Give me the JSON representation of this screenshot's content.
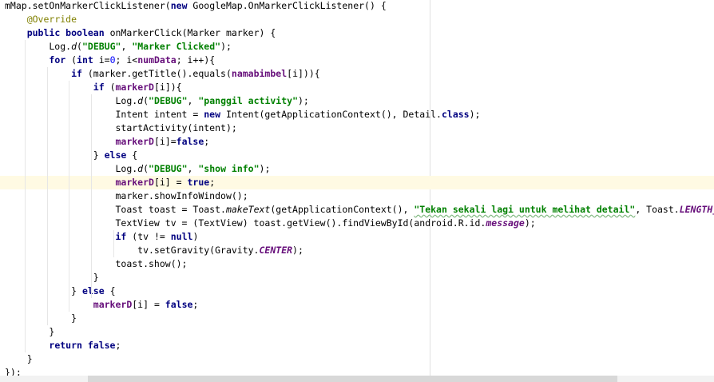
{
  "editor": {
    "lines": [
      [
        {
          "t": "mMap.setOnMarkerClickListener(",
          "c": "t-plain"
        },
        {
          "t": "new",
          "c": "t-kw"
        },
        {
          "t": " GoogleMap.OnMarkerClickListener() {",
          "c": "t-plain"
        }
      ],
      [
        {
          "t": "    ",
          "c": "t-plain"
        },
        {
          "t": "@Override",
          "c": "t-ann"
        }
      ],
      [
        {
          "t": "    ",
          "c": "t-plain"
        },
        {
          "t": "public boolean",
          "c": "t-kw"
        },
        {
          "t": " onMarkerClick(Marker marker) {",
          "c": "t-plain"
        }
      ],
      [
        {
          "t": "        Log.",
          "c": "t-plain"
        },
        {
          "t": "d",
          "c": "t-smeth"
        },
        {
          "t": "(",
          "c": "t-plain"
        },
        {
          "t": "\"DEBUG\"",
          "c": "t-str"
        },
        {
          "t": ", ",
          "c": "t-plain"
        },
        {
          "t": "\"Marker Clicked\"",
          "c": "t-str"
        },
        {
          "t": ");",
          "c": "t-plain"
        }
      ],
      [
        {
          "t": "        ",
          "c": "t-plain"
        },
        {
          "t": "for",
          "c": "t-kw"
        },
        {
          "t": " (",
          "c": "t-plain"
        },
        {
          "t": "int",
          "c": "t-kw"
        },
        {
          "t": " i=",
          "c": "t-plain"
        },
        {
          "t": "0",
          "c": "t-num"
        },
        {
          "t": "; i<",
          "c": "t-plain"
        },
        {
          "t": "numData",
          "c": "t-field"
        },
        {
          "t": "; i++){",
          "c": "t-plain"
        }
      ],
      [
        {
          "t": "            ",
          "c": "t-plain"
        },
        {
          "t": "if",
          "c": "t-kw"
        },
        {
          "t": " (marker.getTitle().equals(",
          "c": "t-plain"
        },
        {
          "t": "namabimbel",
          "c": "t-field"
        },
        {
          "t": "[i])){",
          "c": "t-plain"
        }
      ],
      [
        {
          "t": "                ",
          "c": "t-plain"
        },
        {
          "t": "if",
          "c": "t-kw"
        },
        {
          "t": " (",
          "c": "t-plain"
        },
        {
          "t": "markerD",
          "c": "t-field"
        },
        {
          "t": "[i]){",
          "c": "t-plain"
        }
      ],
      [
        {
          "t": "                    Log.",
          "c": "t-plain"
        },
        {
          "t": "d",
          "c": "t-smeth"
        },
        {
          "t": "(",
          "c": "t-plain"
        },
        {
          "t": "\"DEBUG\"",
          "c": "t-str"
        },
        {
          "t": ", ",
          "c": "t-plain"
        },
        {
          "t": "\"panggil activity\"",
          "c": "t-str"
        },
        {
          "t": ");",
          "c": "t-plain"
        }
      ],
      [
        {
          "t": "                    Intent intent = ",
          "c": "t-plain"
        },
        {
          "t": "new",
          "c": "t-kw"
        },
        {
          "t": " Intent(getApplicationContext(), Detail.",
          "c": "t-plain"
        },
        {
          "t": "class",
          "c": "t-kw"
        },
        {
          "t": ");",
          "c": "t-plain"
        }
      ],
      [
        {
          "t": "                    startActivity(intent);",
          "c": "t-plain"
        }
      ],
      [
        {
          "t": "                    ",
          "c": "t-plain"
        },
        {
          "t": "markerD",
          "c": "t-field"
        },
        {
          "t": "[i]=",
          "c": "t-plain"
        },
        {
          "t": "false",
          "c": "t-kw"
        },
        {
          "t": ";",
          "c": "t-plain"
        }
      ],
      [
        {
          "t": "                } ",
          "c": "t-plain"
        },
        {
          "t": "else",
          "c": "t-kw"
        },
        {
          "t": " {",
          "c": "t-plain"
        }
      ],
      [
        {
          "t": "                    Log.",
          "c": "t-plain"
        },
        {
          "t": "d",
          "c": "t-smeth"
        },
        {
          "t": "(",
          "c": "t-plain"
        },
        {
          "t": "\"DEBUG\"",
          "c": "t-str"
        },
        {
          "t": ", ",
          "c": "t-plain"
        },
        {
          "t": "\"show info\"",
          "c": "t-str"
        },
        {
          "t": ");",
          "c": "t-plain"
        }
      ],
      [
        {
          "t": "                    ",
          "c": "t-plain"
        },
        {
          "t": "markerD",
          "c": "t-field"
        },
        {
          "t": "[i] = ",
          "c": "t-plain"
        },
        {
          "t": "true",
          "c": "t-kw"
        },
        {
          "t": ";",
          "c": "t-plain"
        }
      ],
      [
        {
          "t": "                    marker.showInfoWindow();",
          "c": "t-plain"
        }
      ],
      [
        {
          "t": "                    Toast toast = Toast.",
          "c": "t-plain"
        },
        {
          "t": "makeText",
          "c": "t-smeth"
        },
        {
          "t": "(getApplicationContext(), ",
          "c": "t-plain"
        },
        {
          "t": "\"Tekan sekali lagi untuk melihat detail\"",
          "c": "t-str t-typo"
        },
        {
          "t": ", Toast.",
          "c": "t-plain"
        },
        {
          "t": "LENGTH_SHORT",
          "c": "t-static"
        }
      ],
      [
        {
          "t": "                    TextView tv = (TextView) toast.getView().findViewById(android.R.id.",
          "c": "t-plain"
        },
        {
          "t": "message",
          "c": "t-static"
        },
        {
          "t": ");",
          "c": "t-plain"
        }
      ],
      [
        {
          "t": "                    ",
          "c": "t-plain"
        },
        {
          "t": "if",
          "c": "t-kw"
        },
        {
          "t": " (tv != ",
          "c": "t-plain"
        },
        {
          "t": "null",
          "c": "t-kw"
        },
        {
          "t": ")",
          "c": "t-plain"
        }
      ],
      [
        {
          "t": "                        tv.setGravity(Gravity.",
          "c": "t-plain"
        },
        {
          "t": "CENTER",
          "c": "t-static"
        },
        {
          "t": ");",
          "c": "t-plain"
        }
      ],
      [
        {
          "t": "                    toast.show();",
          "c": "t-plain"
        }
      ],
      [
        {
          "t": "                }",
          "c": "t-plain"
        }
      ],
      [
        {
          "t": "            } ",
          "c": "t-plain"
        },
        {
          "t": "else",
          "c": "t-kw"
        },
        {
          "t": " {",
          "c": "t-plain"
        }
      ],
      [
        {
          "t": "                ",
          "c": "t-plain"
        },
        {
          "t": "markerD",
          "c": "t-field"
        },
        {
          "t": "[i] = ",
          "c": "t-plain"
        },
        {
          "t": "false",
          "c": "t-kw"
        },
        {
          "t": ";",
          "c": "t-plain"
        }
      ],
      [
        {
          "t": "            }",
          "c": "t-plain"
        }
      ],
      [
        {
          "t": "        }",
          "c": "t-plain"
        }
      ],
      [
        {
          "t": "        ",
          "c": "t-plain"
        },
        {
          "t": "return false",
          "c": "t-kw"
        },
        {
          "t": ";",
          "c": "t-plain"
        }
      ],
      [
        {
          "t": "    }",
          "c": "t-plain"
        }
      ],
      [
        {
          "t": "});",
          "c": "t-plain"
        }
      ]
    ],
    "highlighted_lines": [
      13
    ]
  },
  "colors": {
    "keyword": "#000080",
    "string": "#008000",
    "field": "#660e7a",
    "annotation": "#808000",
    "number": "#0000ff",
    "caret_line": "#fffae3"
  }
}
